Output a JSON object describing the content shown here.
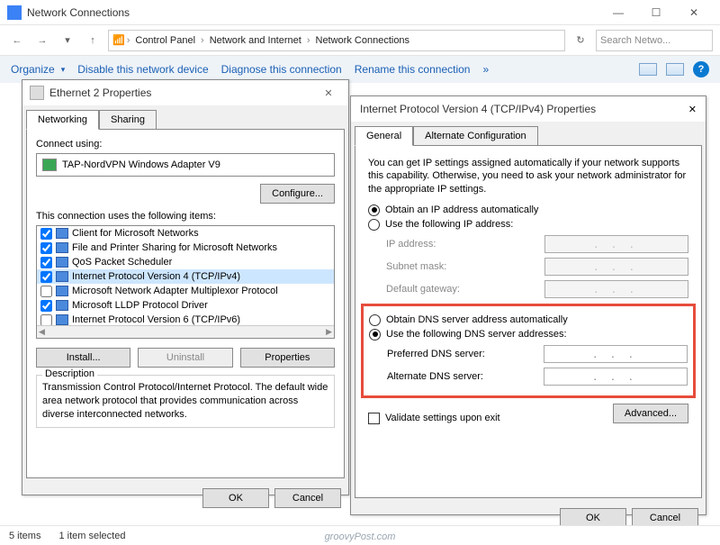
{
  "window": {
    "title": "Network Connections",
    "min": "—",
    "max": "☐",
    "close": "✕",
    "search_placeholder": "Search Netwo...",
    "refresh": "↻"
  },
  "breadcrumb": [
    "Control Panel",
    "Network and Internet",
    "Network Connections"
  ],
  "nav": {
    "back": "←",
    "fwd": "→",
    "up": "↑",
    "sep": "›"
  },
  "toolbar": {
    "organize": "Organize",
    "disable": "Disable this network device",
    "diagnose": "Diagnose this connection",
    "rename": "Rename this connection",
    "more": "»",
    "help": "?"
  },
  "dlg1": {
    "title": "Ethernet 2 Properties",
    "tab_net": "Networking",
    "tab_share": "Sharing",
    "connect_using": "Connect using:",
    "adapter": "TAP-NordVPN Windows Adapter V9",
    "configure": "Configure...",
    "uses_items": "This connection uses the following items:",
    "items": [
      {
        "label": "Client for Microsoft Networks",
        "checked": true
      },
      {
        "label": "File and Printer Sharing for Microsoft Networks",
        "checked": true
      },
      {
        "label": "QoS Packet Scheduler",
        "checked": true
      },
      {
        "label": "Internet Protocol Version 4 (TCP/IPv4)",
        "checked": true,
        "selected": true
      },
      {
        "label": "Microsoft Network Adapter Multiplexor Protocol",
        "checked": false
      },
      {
        "label": "Microsoft LLDP Protocol Driver",
        "checked": true
      },
      {
        "label": "Internet Protocol Version 6 (TCP/IPv6)",
        "checked": false
      }
    ],
    "install": "Install...",
    "uninstall": "Uninstall",
    "properties": "Properties",
    "desc_legend": "Description",
    "desc": "Transmission Control Protocol/Internet Protocol. The default wide area network protocol that provides communication across diverse interconnected networks.",
    "ok": "OK",
    "cancel": "Cancel"
  },
  "dlg2": {
    "title": "Internet Protocol Version 4 (TCP/IPv4) Properties",
    "tab_general": "General",
    "tab_alt": "Alternate Configuration",
    "info": "You can get IP settings assigned automatically if your network supports this capability. Otherwise, you need to ask your network administrator for the appropriate IP settings.",
    "ip_auto": "Obtain an IP address automatically",
    "ip_manual": "Use the following IP address:",
    "ip_addr": "IP address:",
    "subnet": "Subnet mask:",
    "gateway": "Default gateway:",
    "dns_auto": "Obtain DNS server address automatically",
    "dns_manual": "Use the following DNS server addresses:",
    "dns_pref": "Preferred DNS server:",
    "dns_alt": "Alternate DNS server:",
    "validate": "Validate settings upon exit",
    "advanced": "Advanced...",
    "ok": "OK",
    "cancel": "Cancel",
    "dots": ".   .   ."
  },
  "status": {
    "count": "5 items",
    "sel": "1 item selected"
  },
  "watermark": "groovyPost.com"
}
